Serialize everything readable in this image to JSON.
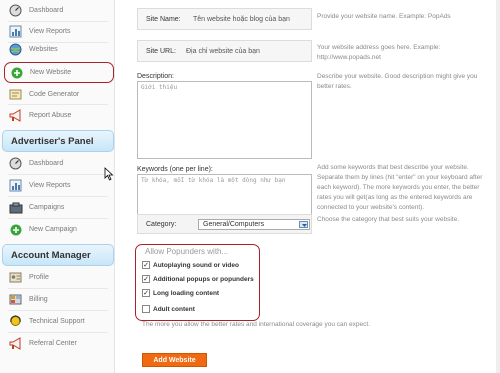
{
  "nav_top": [
    {
      "label": "Dashboard",
      "icon": "dashboard-icon"
    },
    {
      "label": "View Reports",
      "icon": "report-icon"
    },
    {
      "label": "Websites",
      "icon": "globe-icon"
    },
    {
      "label": "New Website",
      "icon": "add-icon"
    },
    {
      "label": "Code Generator",
      "icon": "code-icon"
    },
    {
      "label": "Report Abuse",
      "icon": "megaphone-icon"
    }
  ],
  "advertiser_panel": {
    "title": "Advertiser's Panel",
    "items": [
      {
        "label": "Dashboard",
        "icon": "dashboard-icon"
      },
      {
        "label": "View Reports",
        "icon": "report-icon"
      },
      {
        "label": "Campaigns",
        "icon": "campaign-icon"
      },
      {
        "label": "New Campaign",
        "icon": "add-icon"
      }
    ]
  },
  "account_manager": {
    "title": "Account Manager",
    "items": [
      {
        "label": "Profile",
        "icon": "profile-icon"
      },
      {
        "label": "Billing",
        "icon": "billing-icon"
      },
      {
        "label": "Technical Support",
        "icon": "support-icon"
      },
      {
        "label": "Referral Center",
        "icon": "megaphone-icon"
      }
    ]
  },
  "form": {
    "site_name_label": "Site Name:",
    "site_name_value": "Tên website hoặc blog của bạn",
    "site_name_help": "Provide your website name. Example: PopAds",
    "site_url_label": "Site URL:",
    "site_url_value": "Địa chỉ website của bạn",
    "site_url_help": "Your website address goes here. Example: http://www.popads.net",
    "description_label": "Description:",
    "description_value": "Giới thiệu",
    "description_help": "Describe your website. Good description might give you better rates.",
    "keywords_label": "Keywords (one per line):",
    "keywords_value": "Từ khóa, mỗi từ khóa là một dòng như bạn",
    "keywords_help": "Add some keywords that best describe your website. Separate them by lines (hit \"enter\" on your keyboard after each keyword). The more keywords you enter, the better rates you will get(as long as the entered keywords are connected to your website's content).",
    "category_label": "Category:",
    "category_value": "General/Computers",
    "category_help": "Choose the category that best suits your website.",
    "popunders_heading": "Allow Popunders with...",
    "options": [
      {
        "label": "Autoplaying sound or video",
        "checked": true
      },
      {
        "label": "Additional popups or popunders",
        "checked": true
      },
      {
        "label": "Long loading content",
        "checked": true
      },
      {
        "label": "Adult content",
        "checked": false
      }
    ],
    "options_note": "The more you allow the better rates and international coverage you can expect.",
    "submit_label": "Add Website"
  },
  "colors": {
    "accent": "#ef6a12",
    "highlight": "#a8222c",
    "panel": "#c8e6f8"
  }
}
